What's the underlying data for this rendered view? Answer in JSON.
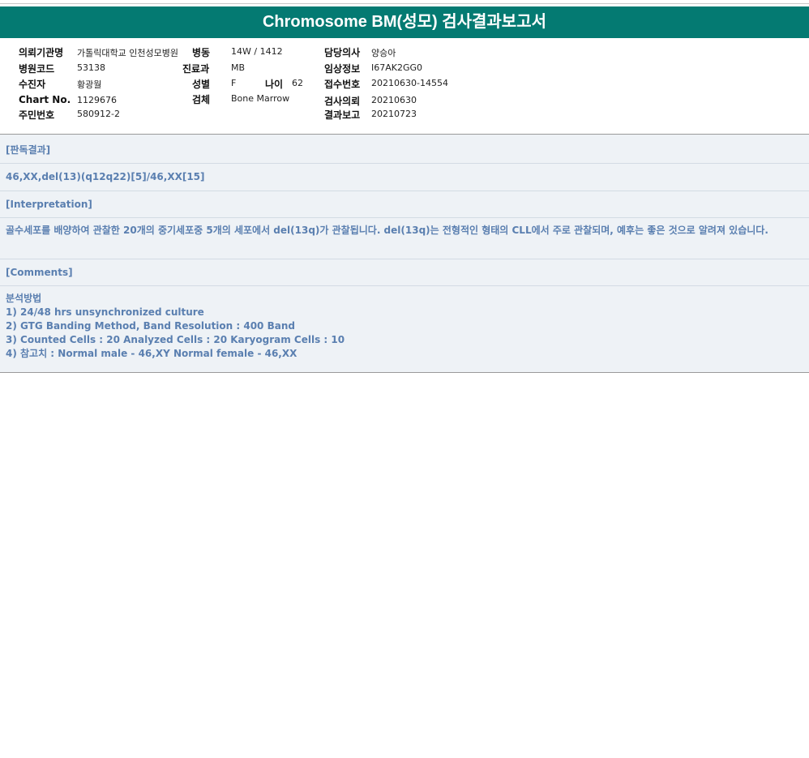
{
  "title": "Chromosome BM(성모) 검사결과보고서",
  "header": {
    "col1": [
      {
        "label": "의뢰기관명",
        "value": "가톨릭대학교 인천성모병원"
      },
      {
        "label": "병원코드",
        "value": "53138"
      },
      {
        "label": "수진자",
        "value": "황광월"
      },
      {
        "label": "Chart No.",
        "value": "1129676"
      },
      {
        "label": "주민번호",
        "value": "580912-2"
      }
    ],
    "col2": {
      "ward": {
        "label": "병동",
        "value": "14W / 1412"
      },
      "dept": {
        "label": "진료과",
        "value": "MB"
      },
      "sex": {
        "label": "성별",
        "value": "F"
      },
      "age": {
        "label": "나이",
        "value": "62"
      },
      "specimen": {
        "label": "검체",
        "value": "Bone Marrow"
      }
    },
    "col3": [
      {
        "label": "담당의사",
        "value": "양승아"
      },
      {
        "label": "임상정보",
        "value": "I67AK2GG0"
      },
      {
        "label": "접수번호",
        "value": "20210630-14554"
      },
      {
        "label": "검사의뢰",
        "value": "20210630"
      },
      {
        "label": "결과보고",
        "value": "20210723"
      }
    ]
  },
  "sections": {
    "result_heading": "[판독결과]",
    "result_value": "46,XX,del(13)(q12q22)[5]/46,XX[15]",
    "interpretation_heading": "[Interpretation]",
    "interpretation_text": "골수세포를 배양하여 관찰한 20개의 중기세포중 5개의 세포에서 del(13q)가 관찰됩니다. del(13q)는 전형적인 형태의 CLL에서 주로 관찰되며, 예후는 좋은 것으로 알려져 있습니다.",
    "comments_heading": "[Comments]",
    "comments_lines": [
      "분석방법",
      "1) 24/48 hrs unsynchronized culture",
      "2) GTG Banding Method, Band Resolution : 400 Band",
      "3) Counted Cells : 20 Analyzed Cells : 20 Karyogram Cells : 10",
      "4) 참고치 : Normal male - 46,XY Normal female - 46,XX"
    ]
  },
  "colors": {
    "title_bar": "#047a72",
    "section_text": "#5a7fb0",
    "panel_bg": "#eef2f6"
  }
}
